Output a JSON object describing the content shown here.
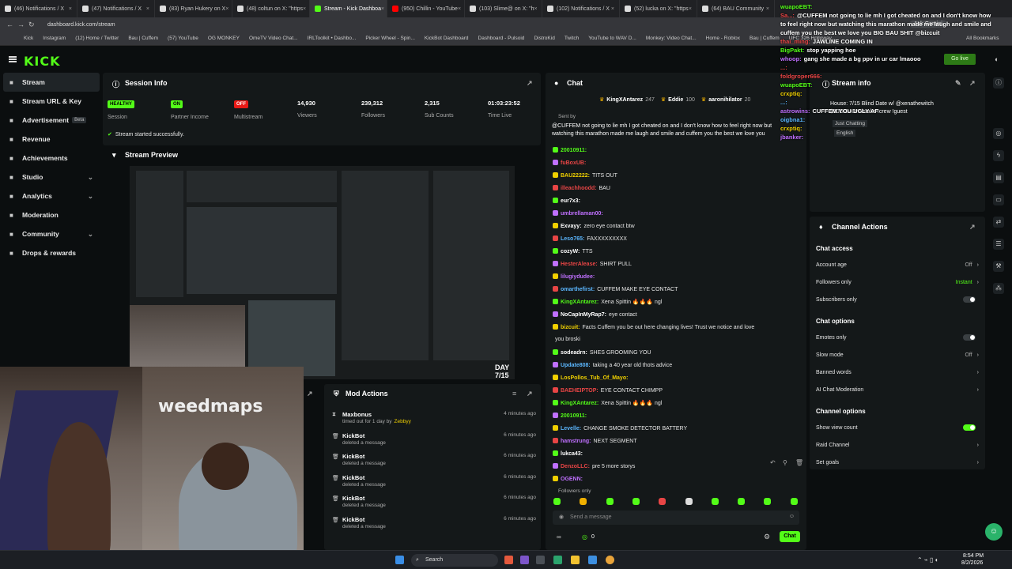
{
  "tabs": [
    {
      "label": "(46) Notifications / X",
      "active": false
    },
    {
      "label": "(47) Notifications / X",
      "active": false
    },
    {
      "label": "(83) Ryan Hukery on X",
      "active": false
    },
    {
      "label": "(48) coltun on X: \"https",
      "active": false
    },
    {
      "label": "Stream - Kick Dashboa",
      "active": true
    },
    {
      "label": "(950) Chillin - YouTube",
      "active": false
    },
    {
      "label": "(103) Slime@ on X: \"h",
      "active": false
    },
    {
      "label": "(102) Notifications / X",
      "active": false
    },
    {
      "label": "(52) lucka on X: \"https",
      "active": false
    },
    {
      "label": "(64) BAU Community",
      "active": false
    }
  ],
  "browser": {
    "url": "dashboard.kick.com/stream",
    "ask_gemini": "Ask Gemini",
    "all_bookmarks": "All Bookmarks"
  },
  "bookmarks": [
    "Kick",
    "Instagram",
    "(12) Home / Twitter",
    "Bau | Cuffem",
    "(57) YouTube",
    "OG MONKEY",
    "OmeTV Video Chat...",
    "IRLToolkit • Dashbo...",
    "Picker Wheel - Spin...",
    "KickBot Dashboard",
    "Dashboard - Pulsoid",
    "DistroKid",
    "Twitch",
    "YouTube to WAV D...",
    "Monkey: Video Chat...",
    "Home - Roblox",
    "Bau | Cuffem",
    "UFC 326 Holloway..."
  ],
  "app": {
    "logo": "KICK",
    "go_live": "Go live"
  },
  "sidebar": {
    "items": [
      {
        "label": "Stream",
        "active": true,
        "icon": "stream-icon",
        "chev": false
      },
      {
        "label": "Stream URL & Key",
        "active": false,
        "icon": "key-icon",
        "chev": false
      },
      {
        "label": "Advertisement",
        "active": false,
        "icon": "megaphone-icon",
        "chev": false,
        "badge": "Beta"
      },
      {
        "label": "Revenue",
        "active": false,
        "icon": "dollar-icon",
        "chev": false
      },
      {
        "label": "Achievements",
        "active": false,
        "icon": "trophy-icon",
        "chev": false
      },
      {
        "label": "Studio",
        "active": false,
        "icon": "studio-icon",
        "chev": true
      },
      {
        "label": "Analytics",
        "active": false,
        "icon": "analytics-icon",
        "chev": true
      },
      {
        "label": "Moderation",
        "active": false,
        "icon": "hammer-icon",
        "chev": false
      },
      {
        "label": "Community",
        "active": false,
        "icon": "community-icon",
        "chev": true
      },
      {
        "label": "Drops & rewards",
        "active": false,
        "icon": "gift-icon",
        "chev": false
      }
    ]
  },
  "session": {
    "title": "Session Info",
    "stats": [
      {
        "value": "HEALTHY",
        "label": "Session",
        "badge": "green"
      },
      {
        "value": "ON",
        "label": "Partner Income",
        "badge": "green"
      },
      {
        "value": "OFF",
        "label": "Multistream",
        "badge": "red"
      },
      {
        "value": "14,930",
        "label": "Viewers"
      },
      {
        "value": "239,312",
        "label": "Followers"
      },
      {
        "value": "2,315",
        "label": "Sub Counts"
      },
      {
        "value": "01:03:23:52",
        "label": "Time Live"
      }
    ],
    "notice": "Stream started successfully."
  },
  "preview": {
    "title": "Stream Preview",
    "day_overlay": "DAY 7/15"
  },
  "webcam": {
    "banner": "weedmaps"
  },
  "mod_actions": {
    "title": "Mod Actions",
    "rows": [
      {
        "name": "Maxbonus",
        "desc": "timed out for 1 day by",
        "by": "Zebbyy",
        "time": "4 minutes ago"
      },
      {
        "name": "KickBot",
        "desc": "deleted a message",
        "time": "6 minutes ago"
      },
      {
        "name": "KickBot",
        "desc": "deleted a message",
        "time": "6 minutes ago"
      },
      {
        "name": "KickBot",
        "desc": "deleted a message",
        "time": "6 minutes ago"
      },
      {
        "name": "KickBot",
        "desc": "deleted a message",
        "time": "6 minutes ago"
      },
      {
        "name": "KickBot",
        "desc": "deleted a message",
        "time": "6 minutes ago"
      }
    ]
  },
  "chat": {
    "title": "Chat",
    "leaderboard": [
      {
        "name": "KingXAntarez",
        "value": "247"
      },
      {
        "name": "Eddie",
        "value": "100"
      },
      {
        "name": "aaronihilator",
        "value": "20"
      }
    ],
    "pinned_sender": "Sent by",
    "pinned": "@CUFFEM not going to lie mh I got cheated on and I don't know how to feel right now but",
    "pinned2": "watching this marathon made me laugh and smile and cuffem you the best we love you",
    "messages": [
      {
        "user": "20010911:",
        "text": "",
        "color": "#53fc18"
      },
      {
        "user": "fuBoxUB:",
        "text": "",
        "color": "#e84545"
      },
      {
        "user": "BAU22222:",
        "text": "TITS OUT",
        "color": "#f0d000"
      },
      {
        "user": "illeachhoodd:",
        "text": "BAU",
        "color": "#e84545"
      },
      {
        "user": "eur7x3:",
        "text": "",
        "color": "#ffffff"
      },
      {
        "user": "umbrellaman00:",
        "text": "",
        "color": "#c070ff"
      },
      {
        "user": "Exvayy:",
        "text": "zero eye contact btw",
        "color": "#ffffff"
      },
      {
        "user": "Leso765:",
        "text": "FAXXXXXXXXX",
        "color": "#5bb7ff"
      },
      {
        "user": "cozyW:",
        "text": "TTS",
        "color": "#ffffff"
      },
      {
        "user": "HesterAlease:",
        "text": "SHIRT PULL",
        "color": "#e84545"
      },
      {
        "user": "lilugiydudee:",
        "text": "",
        "color": "#c070ff"
      },
      {
        "user": "omarthefirst:",
        "text": "CUFFEM MAKE EYE CONTACT",
        "color": "#5bb7ff"
      },
      {
        "user": "KingXAntarez:",
        "text": "Xena Spittin 🔥🔥🔥 ngl",
        "color": "#53fc18"
      },
      {
        "user": "NoCapInMyRap7:",
        "text": "eye contact",
        "color": "#ffffff"
      },
      {
        "user": "bizcuit:",
        "text": "Facts Cuffem you be out here changing lives! Trust we notice and love",
        "color": "#f0d000"
      },
      {
        "user": "",
        "text": "you broski",
        "color": "#ffffff"
      },
      {
        "user": "sodeadrn:",
        "text": "SHES GROOMING YOU",
        "color": "#ffffff"
      },
      {
        "user": "Update808:",
        "text": "taking a 40 year old thots advice",
        "color": "#5bb7ff"
      },
      {
        "user": "LosPollos_Tub_Of_Mayo:",
        "text": "",
        "color": "#f0d000"
      },
      {
        "user": "BAEHEIPTOP:",
        "text": "EYE CONTACT CHIMPP",
        "color": "#e84545"
      },
      {
        "user": "KingXAntarez:",
        "text": "Xena Spittin 🔥🔥🔥 ngl",
        "color": "#53fc18"
      },
      {
        "user": "20010911:",
        "text": "",
        "color": "#53fc18"
      },
      {
        "user": "Levelle:",
        "text": "CHANGE SMOKE DETECTOR BATTERY",
        "color": "#5bb7ff"
      },
      {
        "user": "hamstrung:",
        "text": "NEXT SEGMENT",
        "color": "#c070ff"
      },
      {
        "user": "lukca43:",
        "text": "",
        "color": "#ffffff"
      },
      {
        "user": "DenzoLLC:",
        "text": "pre 5 more storys",
        "color": "#e84545"
      },
      {
        "user": "OGENN:",
        "text": "",
        "color": "#c070ff"
      }
    ],
    "followers_only": "Followers only",
    "input_placeholder": "Send a message",
    "chat_button": "Chat",
    "bottom_count": "0"
  },
  "overlay_chat": [
    {
      "user": "wuapoEBT:",
      "text": "",
      "color": "#53fc18"
    },
    {
      "user": "Sa...:",
      "text": "@CUFFEM not going to lie mh I got cheated on and I don't know how",
      "color": "#e84545"
    },
    {
      "user": "",
      "text": "to feel right now but watching this marathon made me laugh and smile and",
      "color": "#fff"
    },
    {
      "user": "",
      "text": "cuffem you the best we love you BIG BAU SHIT @bizcuit",
      "color": "#fff"
    },
    {
      "user": "thai_ming:",
      "text": "JAWLINE COMING IN",
      "color": "#e84545"
    },
    {
      "user": "BigPakt:",
      "text": "stop yapping hoe",
      "color": "#53fc18"
    },
    {
      "user": "whoop:",
      "text": "gang she made a bg ppv in ur car lmaooo",
      "color": "#c070ff"
    },
    {
      "user": "...:",
      "text": "",
      "color": "#e84545"
    },
    {
      "user": "foldgroper666:",
      "text": "",
      "color": "#e84545"
    },
    {
      "user": "wuapoEBT:",
      "text": "",
      "color": "#53fc18"
    },
    {
      "user": "crxptiq:",
      "text": "",
      "color": "#f0d000"
    },
    {
      "user": "...:",
      "text": "",
      "color": "#5bb7ff"
    },
    {
      "user": "astrowins:",
      "text": "CUFFEM YOU UGLY AF",
      "color": "#c070ff"
    },
    {
      "user": "oigbna1:",
      "text": "",
      "color": "#5bb7ff"
    },
    {
      "user": "crxptiq:",
      "text": "",
      "color": "#f0d000"
    },
    {
      "user": "jbanker:",
      "text": "",
      "color": "#c070ff"
    }
  ],
  "stream_info": {
    "title": "Stream info",
    "stream_title": "House: 7/15 Blind Date w/ @xenathewitch",
    "stream_sub": "$10DEMON lstake !crew !guest",
    "category": "Just Chatting",
    "language": "English"
  },
  "channel_actions": {
    "title": "Channel Actions",
    "access_heading": "Chat access",
    "access": [
      {
        "label": "Account age",
        "value": "Off"
      },
      {
        "label": "Followers only",
        "value": "Instant"
      },
      {
        "label": "Subscribers only",
        "toggle": false
      }
    ],
    "options_heading": "Chat options",
    "options": [
      {
        "label": "Emotes only",
        "toggle": false
      },
      {
        "label": "Slow mode",
        "value": "Off"
      },
      {
        "label": "Banned words",
        "value": ""
      },
      {
        "label": "AI Chat Moderation",
        "value": ""
      }
    ],
    "channel_heading": "Channel options",
    "channel": [
      {
        "label": "Show view count",
        "toggle": true
      },
      {
        "label": "Raid Channel",
        "value": ""
      },
      {
        "label": "Set goals",
        "value": ""
      }
    ]
  },
  "taskbar": {
    "search": "Search",
    "time": "8:54 PM",
    "date": "8/2/2026"
  }
}
